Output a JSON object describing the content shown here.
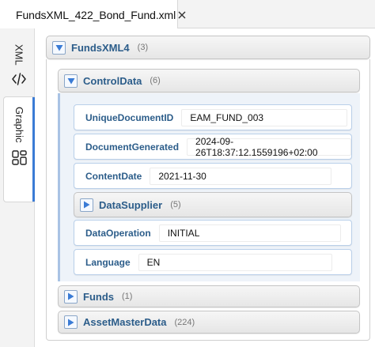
{
  "tab": {
    "title": "FundsXML_422_Bond_Fund.xml",
    "close_icon": "close-icon"
  },
  "sidebar": {
    "xml_tab": {
      "label": "XML",
      "icon": "code-icon"
    },
    "graphic_tab": {
      "label": "Graphic",
      "icon": "layout-icon"
    }
  },
  "root": {
    "name": "FundsXML4",
    "count": "(3)",
    "control_data": {
      "name": "ControlData",
      "count": "(6)",
      "rows": [
        {
          "label": "UniqueDocumentID",
          "value": "EAM_FUND_003"
        },
        {
          "label": "DocumentGenerated",
          "value": "2024-09-26T18:37:12.1559196+02:00"
        },
        {
          "label": "ContentDate",
          "value": "2021-11-30"
        },
        {
          "label": "DataSupplier",
          "count": "(5)"
        },
        {
          "label": "DataOperation",
          "value": "INITIAL"
        },
        {
          "label": "Language",
          "value": "EN"
        }
      ]
    },
    "funds": {
      "name": "Funds",
      "count": "(1)"
    },
    "asset_master_data": {
      "name": "AssetMasterData",
      "count": "(224)"
    }
  },
  "colors": {
    "accent": "#3a7bd5",
    "label": "#2c5d8a",
    "row_border": "#b9cfe9"
  }
}
